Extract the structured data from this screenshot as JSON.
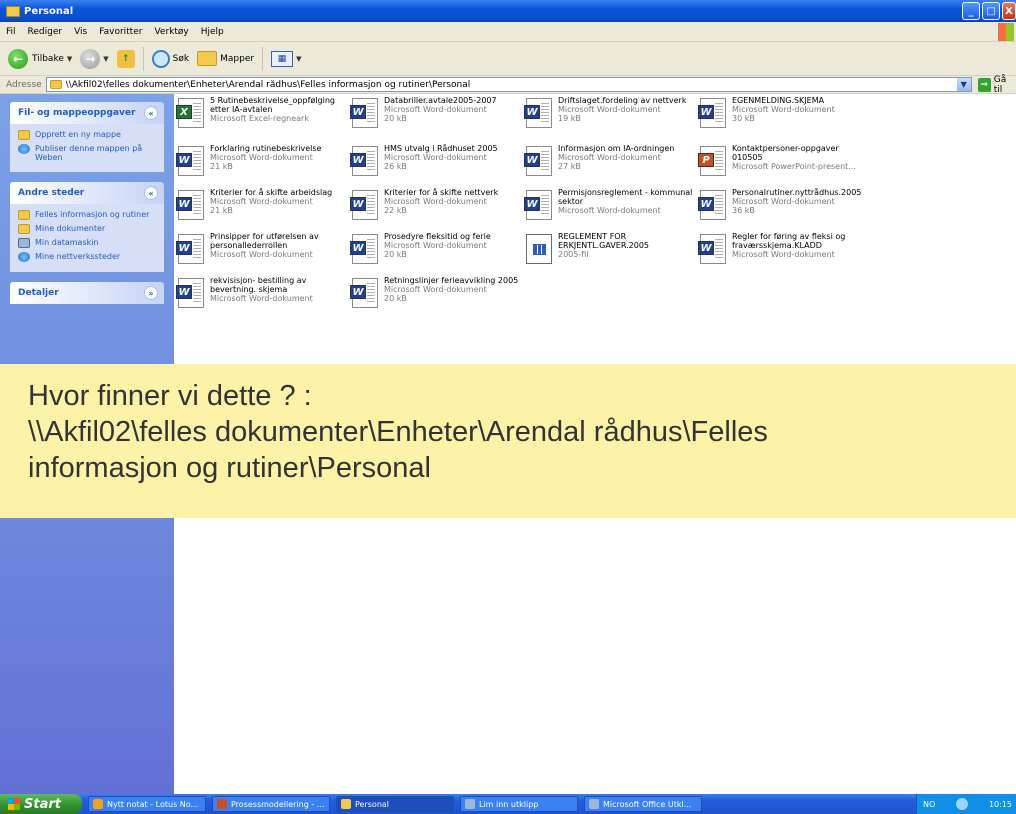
{
  "window": {
    "title": "Personal",
    "buttons": [
      "_",
      "□",
      "X"
    ]
  },
  "menu": [
    "Fil",
    "Rediger",
    "Vis",
    "Favoritter",
    "Verktøy",
    "Hjelp"
  ],
  "toolbar": {
    "back": "Tilbake",
    "search": "Søk",
    "folders": "Mapper"
  },
  "address": {
    "label": "Adresse",
    "path": "\\\\Akfil02\\felles dokumenter\\Enheter\\Arendal rådhus\\Felles informasjon og rutiner\\Personal",
    "go": "Gå til"
  },
  "panels": [
    {
      "title": "Fil- og mappeoppgaver",
      "chevron": "«",
      "links": [
        {
          "label": "Opprett en ny mappe",
          "icon": "new-folder-icon"
        },
        {
          "label": "Publiser denne mappen på Weben",
          "icon": "publish-web-icon"
        }
      ]
    },
    {
      "title": "Andre steder",
      "chevron": "«",
      "links": [
        {
          "label": "Felles informasjon og rutiner",
          "icon": "folder-icon"
        },
        {
          "label": "Mine dokumenter",
          "icon": "folder-icon"
        },
        {
          "label": "Min datamaskin",
          "icon": "computer-icon"
        },
        {
          "label": "Mine nettverkssteder",
          "icon": "network-icon"
        }
      ]
    },
    {
      "title": "Detaljer",
      "chevron": "»",
      "links": []
    }
  ],
  "files": [
    {
      "name": "5 Rutinebeskrivelse_oppfølging etter IA-avtalen",
      "type": "Microsoft Excel-regneark",
      "size": "",
      "kind": "excel"
    },
    {
      "name": "Databriller.avtale2005-2007",
      "type": "Microsoft Word-dokument",
      "size": "20 kB",
      "kind": "word"
    },
    {
      "name": "Driftslaget.fordeling av nettverk",
      "type": "Microsoft Word-dokument",
      "size": "19 kB",
      "kind": "word"
    },
    {
      "name": "EGENMELDING.SKJEMA",
      "type": "Microsoft Word-dokument",
      "size": "30 kB",
      "kind": "word"
    },
    {
      "name": "Forklaring rutinebeskrivelse",
      "type": "Microsoft Word-dokument",
      "size": "21 kB",
      "kind": "word"
    },
    {
      "name": "HMS utvalg i Rådhuset 2005",
      "type": "Microsoft Word-dokument",
      "size": "26 kB",
      "kind": "word"
    },
    {
      "name": "Informasjon om IA-ordningen",
      "type": "Microsoft Word-dokument",
      "size": "27 kB",
      "kind": "word"
    },
    {
      "name": "Kontaktpersoner-oppgaver 010505",
      "type": "Microsoft PowerPoint-present...",
      "size": "",
      "kind": "ppt"
    },
    {
      "name": "Kriterier for å skifte arbeidslag",
      "type": "Microsoft Word-dokument",
      "size": "21 kB",
      "kind": "word"
    },
    {
      "name": "Kriterier for å skifte nettverk",
      "type": "Microsoft Word-dokument",
      "size": "22 kB",
      "kind": "word"
    },
    {
      "name": "Permisjonsreglement - kommunal sektor",
      "type": "Microsoft Word-dokument",
      "size": "",
      "kind": "word"
    },
    {
      "name": "Personalrutiner.nyttrådhus.2005",
      "type": "Microsoft Word-dokument",
      "size": "36 kB",
      "kind": "word"
    },
    {
      "name": "Prinsipper for utførelsen av personallederrollen",
      "type": "Microsoft Word-dokument",
      "size": "",
      "kind": "word"
    },
    {
      "name": "Prosedyre fleksitid og ferie",
      "type": "Microsoft Word-dokument",
      "size": "20 kB",
      "kind": "word"
    },
    {
      "name": "REGLEMENT FOR ERKJENTL.GAVER.2005",
      "type": "2005-fil",
      "size": "",
      "kind": "other"
    },
    {
      "name": "Regler for føring av fleksi og fraværsskjema.KLADD",
      "type": "Microsoft Word-dokument",
      "size": "",
      "kind": "word"
    },
    {
      "name": "rekvisisjon- bestilling av bevertning. skjema",
      "type": "Microsoft Word-dokument",
      "size": "",
      "kind": "word"
    },
    {
      "name": "Retningslinjer ferieavvikling 2005",
      "type": "Microsoft Word-dokument",
      "size": "20 kB",
      "kind": "word"
    }
  ],
  "overlay": {
    "line1": "Hvor finner vi dette ? :",
    "line2": "\\\\Akfil02\\felles dokumenter\\Enheter\\Arendal rådhus\\Felles",
    "line3": "informasjon og rutiner\\Personal"
  },
  "taskbar": {
    "start": "Start",
    "tasks": [
      {
        "label": "Nytt notat - Lotus No...",
        "color": "#f2a21b"
      },
      {
        "label": "Prosessmodellering - ...",
        "color": "#c8501e"
      },
      {
        "label": "Personal",
        "color": "#f2c94c",
        "active": true
      },
      {
        "label": "Lim inn utklipp",
        "color": "#9fb7d6"
      },
      {
        "label": "Microsoft Office Utkl...",
        "color": "#9fb7d6"
      }
    ],
    "tray": {
      "lang": "NO",
      "clock": "10:15"
    }
  }
}
